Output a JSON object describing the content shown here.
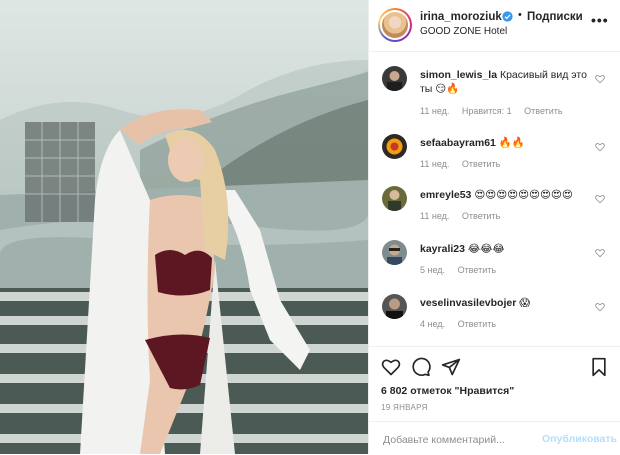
{
  "post": {
    "username": "irina_moroziuk",
    "follow_dot": "•",
    "follow_label": "Подписки",
    "location": "GOOD ZONE Hotel",
    "more": "•••",
    "likes": "6 802 отметок \"Нравится\"",
    "date": "19 ЯНВАРЯ",
    "comment_placeholder": "Добавьте комментарий...",
    "publish_label": "Опубликовать"
  },
  "comments": [
    {
      "user": "simon_lewis_la",
      "text": "Красивый вид это ты 😏🔥",
      "time": "11 нед.",
      "likes": "Нравится: 1",
      "reply": "Ответить"
    },
    {
      "user": "sefaabayram61",
      "text": "🔥🔥",
      "time": "11 нед.",
      "reply": "Ответить"
    },
    {
      "user": "emreyle53",
      "text": "😍😍😍😍😍😍😍😍😍",
      "time": "11 нед.",
      "reply": "Ответить"
    },
    {
      "user": "kayrali23",
      "text": "😂😂😂",
      "time": "5 нед.",
      "reply": "Ответить"
    },
    {
      "user": "veselinvasilevbojer",
      "text": "😱",
      "time": "4 нед.",
      "reply": "Ответить"
    }
  ],
  "icons": [
    "verified-badge-icon",
    "more-options-icon",
    "heart-icon",
    "comment-icon",
    "share-icon",
    "bookmark-icon"
  ],
  "colors": {
    "verified": "#3897f0",
    "publish_disabled": "#b2dffc",
    "meta_text": "#8e8e8e",
    "border": "#efefef"
  }
}
